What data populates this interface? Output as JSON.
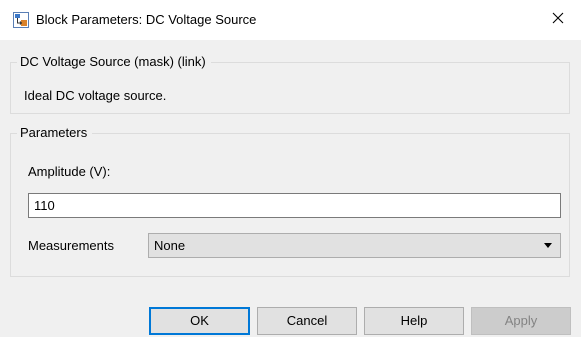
{
  "window": {
    "title": "Block Parameters: DC Voltage Source",
    "close_glyph": "✕"
  },
  "description_group": {
    "title": "DC Voltage Source (mask) (link)",
    "text": "Ideal DC voltage source."
  },
  "parameters_group": {
    "title": "Parameters",
    "amplitude_label": "Amplitude (V):",
    "amplitude_value": "110",
    "measurements_label": "Measurements",
    "measurements_value": "None"
  },
  "buttons": {
    "ok": "OK",
    "cancel": "Cancel",
    "help": "Help",
    "apply": "Apply"
  },
  "icons": {
    "window_icon": "simulink-block-icon",
    "close_icon": "close-icon",
    "dropdown_icon": "chevron-down-icon"
  },
  "colors": {
    "background": "#f0f0f0",
    "focus_accent": "#0078d7",
    "disabled_text": "#838383"
  }
}
